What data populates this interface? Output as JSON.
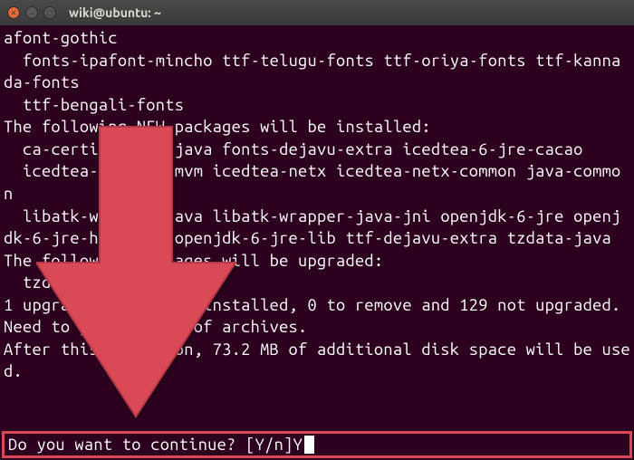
{
  "window": {
    "title": "wiki@ubuntu: ~"
  },
  "terminal": {
    "output": "afont-gothic\n  fonts-ipafont-mincho ttf-telugu-fonts ttf-oriya-fonts ttf-kannada-fonts\n  ttf-bengali-fonts\nThe following NEW packages will be installed:\n  ca-certificates-java fonts-dejavu-extra icedtea-6-jre-cacao\n  icedtea-6-jre-jamvm icedtea-netx icedtea-netx-common java-common\n  libatk-wrapper-java libatk-wrapper-java-jni openjdk-6-jre openjdk-6-jre-headless openjdk-6-jre-lib ttf-dejavu-extra tzdata-java\nThe following packages will be upgraded:\n  tzdata\n1 upgraded, 14 newly installed, 0 to remove and 129 not upgraded.\nNeed to get 42.8 MB of archives.\nAfter this operation, 73.2 MB of additional disk space will be used."
  },
  "prompt": {
    "question": "Do you want to continue? [Y/n] ",
    "input": "Y"
  },
  "colors": {
    "terminal_bg": "#2c001e",
    "highlight_border": "#d94856",
    "arrow_fill": "#d94856"
  }
}
